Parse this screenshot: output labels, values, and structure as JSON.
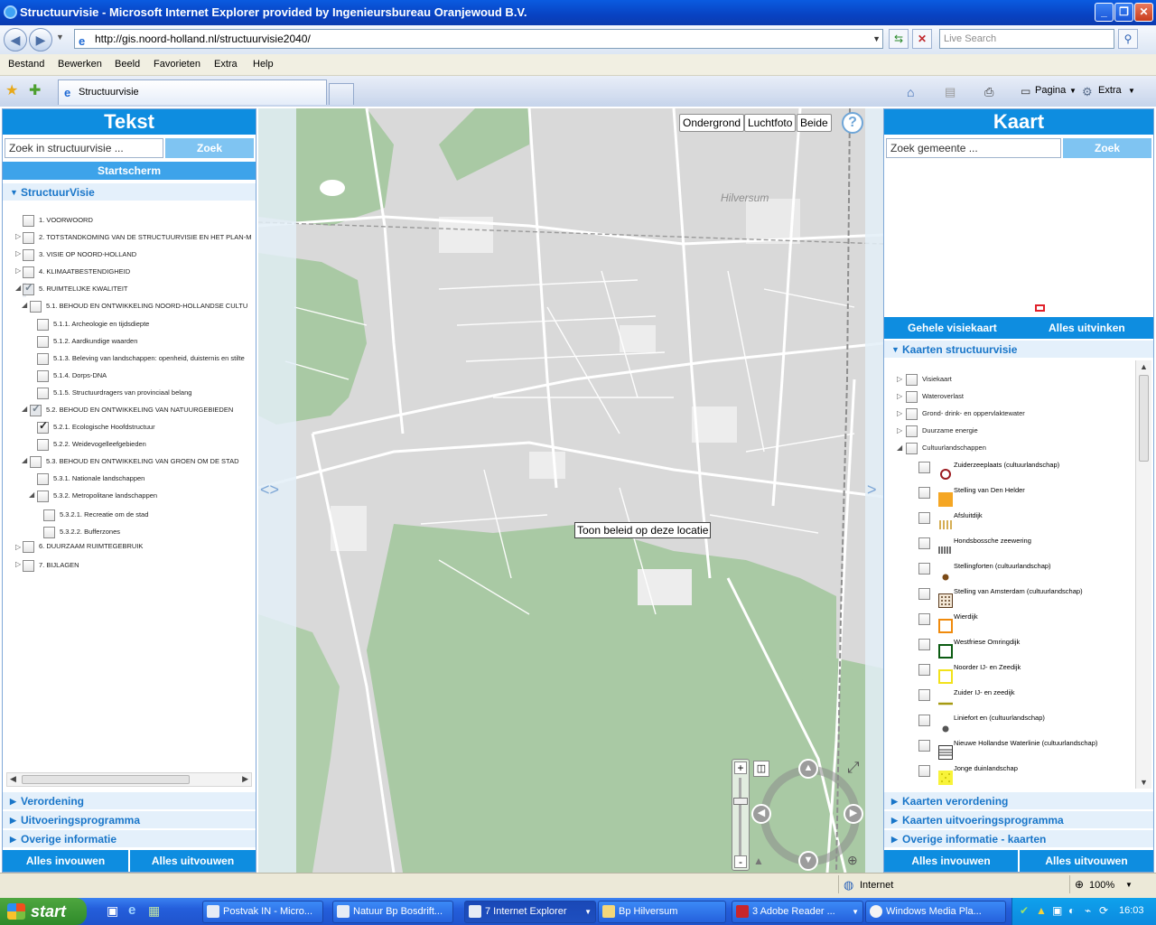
{
  "window": {
    "title": "Structuurvisie - Microsoft Internet Explorer provided by Ingenieursbureau Oranjewoud B.V."
  },
  "address": {
    "url": "http://gis.noord-holland.nl/structuurvisie2040/",
    "search_placeholder": "Live Search"
  },
  "menu": [
    "Bestand",
    "Bewerken",
    "Beeld",
    "Favorieten",
    "Extra",
    "Help"
  ],
  "tab": {
    "label": "Structuurvisie"
  },
  "toolbar": {
    "page": "Pagina",
    "extra": "Extra"
  },
  "left": {
    "title": "Tekst",
    "search_placeholder": "Zoek in structuurvisie ...",
    "search_button": "Zoek",
    "start": "Startscherm",
    "section": "StructuurVisie",
    "items": [
      "1. VOORWOORD",
      "2. TOTSTANDKOMING VAN DE STRUCTUURVISIE EN HET PLAN-M",
      "3. VISIE OP NOORD-HOLLAND",
      "4. KLIMAATBESTENDIGHEID",
      "5. RUIMTELIJKE KWALITEIT",
      "5.1. BEHOUD EN ONTWIKKELING NOORD-HOLLANDSE CULTU",
      "5.1.1. Archeologie en tijdsdiepte",
      "5.1.2. Aardkundige waarden",
      "5.1.3. Beleving van landschappen: openheid, duisternis en stilte",
      "5.1.4. Dorps-DNA",
      "5.1.5. Structuurdragers van provinciaal belang",
      "5.2. BEHOUD EN ONTWIKKELING VAN NATUURGEBIEDEN",
      "5.2.1. Ecologische Hoofdstructuur",
      "5.2.2. Weidevogelleefgebieden",
      "5.3. BEHOUD EN ONTWIKKELING VAN GROEN OM DE STAD",
      "5.3.1. Nationale landschappen",
      "5.3.2. Metropolitane landschappen",
      "5.3.2.1. Recreatie om de stad",
      "5.3.2.2. Bufferzones",
      "6. DUURZAAM RUIMTEGEBRUIK",
      "7. BIJLAGEN"
    ],
    "accordions": [
      "Verordening",
      "Uitvoeringsprogramma",
      "Overige informatie"
    ],
    "collapse_all": "Alles invouwen",
    "expand_all": "Alles uitvouwen"
  },
  "map": {
    "buttons": [
      "Ondergrond",
      "Luchtfoto",
      "Beide"
    ],
    "help": "?",
    "tooltip": "Toon beleid op deze locatie",
    "place": "Hilversum",
    "zoom_plus": "+",
    "zoom_minus": "-"
  },
  "right": {
    "title": "Kaart",
    "search_placeholder": "Zoek gemeente ...",
    "search_button": "Zoek",
    "whole_map": "Gehele visiekaart",
    "uncheck_all": "Alles uitvinken",
    "section": "Kaarten structuurvisie",
    "layers": [
      "Visiekaart",
      "Wateroverlast",
      "Grond- drink- en oppervlaktewater",
      "Duurzame energie",
      "Cultuurlandschappen"
    ],
    "legend": [
      "Zuiderzeeplaats (cultuurlandschap)",
      "Stelling van Den Helder",
      "Afsluitdijk",
      "Hondsbossche zeewering",
      "Stellingforten (cultuurlandschap)",
      "Stelling van Amsterdam (cultuurlandschap)",
      "Wierdijk",
      "Westfriese Omringdijk",
      "Noorder IJ- en Zeedijk",
      "Zuider IJ- en zeedijk",
      "Liniefort en (cultuurlandschap)",
      "Nieuwe Hollandse Waterlinie (cultuurlandschap)",
      "Jonge duinlandschap"
    ],
    "accordions": [
      "Kaarten verordening",
      "Kaarten uitvoeringsprogramma",
      "Overige informatie - kaarten"
    ],
    "collapse_all": "Alles invouwen",
    "expand_all": "Alles uitvouwen"
  },
  "status": {
    "zone": "Internet",
    "zoom": "100%"
  },
  "taskbar": {
    "start": "start",
    "tasks": [
      "Postvak IN - Micro...",
      "Natuur Bp Bosdrift...",
      "7 Internet Explorer",
      "Bp Hilversum",
      "3 Adobe Reader ...",
      "Windows Media Pla..."
    ],
    "clock": "16:03"
  },
  "colors": {
    "accent": "#0E8DE0",
    "map_green": "#A9C9A4",
    "map_gray": "#D7D7D7"
  }
}
